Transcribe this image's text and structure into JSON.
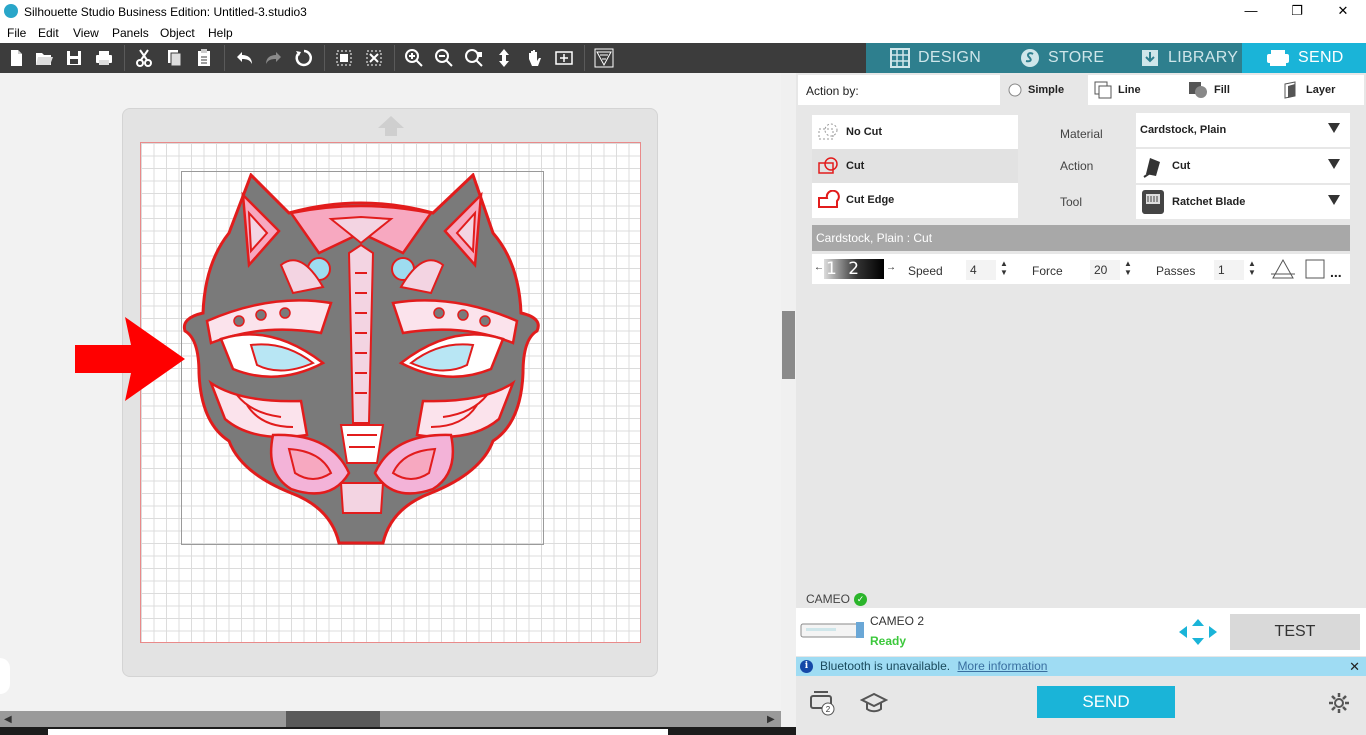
{
  "window": {
    "title": "Silhouette Studio Business Edition: Untitled-3.studio3",
    "minimize": "—",
    "maximize": "❐",
    "close": "✕"
  },
  "menu": [
    "File",
    "Edit",
    "View",
    "Panels",
    "Object",
    "Help"
  ],
  "toolbar_icons": [
    "new-icon",
    "open-icon",
    "save-icon",
    "print-icon",
    "cut-icon",
    "copy-icon",
    "paste-icon",
    "undo-icon",
    "redo-icon",
    "redraw-icon",
    "select-all-icon",
    "deselect-icon",
    "zoom-in-icon",
    "zoom-out-icon",
    "zoom-select-icon",
    "move-icon",
    "pan-icon",
    "fit-to-page-icon",
    "trace-icon"
  ],
  "main_tabs": [
    {
      "label": "DESIGN",
      "icon": "grid-icon",
      "active": false
    },
    {
      "label": "STORE",
      "icon": "store-icon",
      "active": false
    },
    {
      "label": "LIBRARY",
      "icon": "library-icon",
      "active": false
    },
    {
      "label": "SEND",
      "icon": "printer-icon",
      "active": true
    }
  ],
  "colors": {
    "accent": "#1ab4d8",
    "tabs_bg": "#2e7f8e",
    "toolbar_bg": "#3c3c3c",
    "ready": "#3cc83c",
    "cut_line": "#e21c1c"
  },
  "send_panel": {
    "action_by_label": "Action by:",
    "action_by_tabs": [
      "Simple",
      "Line",
      "Fill",
      "Layer"
    ],
    "action_by_selected": "Simple",
    "cut_options": [
      "No Cut",
      "Cut",
      "Cut Edge"
    ],
    "cut_selected": "Cut",
    "material_label": "Material",
    "material_value": "Cardstock, Plain",
    "action_label": "Action",
    "action_value": "Cut",
    "tool_label": "Tool",
    "tool_value": "Ratchet Blade",
    "section_title": "Cardstock, Plain : Cut",
    "blade_numbers": "1 2 3 4 5",
    "speed_label": "Speed",
    "speed_value": "4",
    "force_label": "Force",
    "force_value": "20",
    "passes_label": "Passes",
    "passes_value": "1",
    "more": "..."
  },
  "device": {
    "group_label": "CAMEO",
    "name": "CAMEO 2",
    "status": "Ready",
    "test_label": "TEST"
  },
  "info_bar": {
    "message": "Bluetooth is unavailable.",
    "link": "More information",
    "close": "✕"
  },
  "footer": {
    "send_label": "SEND",
    "queue_badge": "2"
  }
}
